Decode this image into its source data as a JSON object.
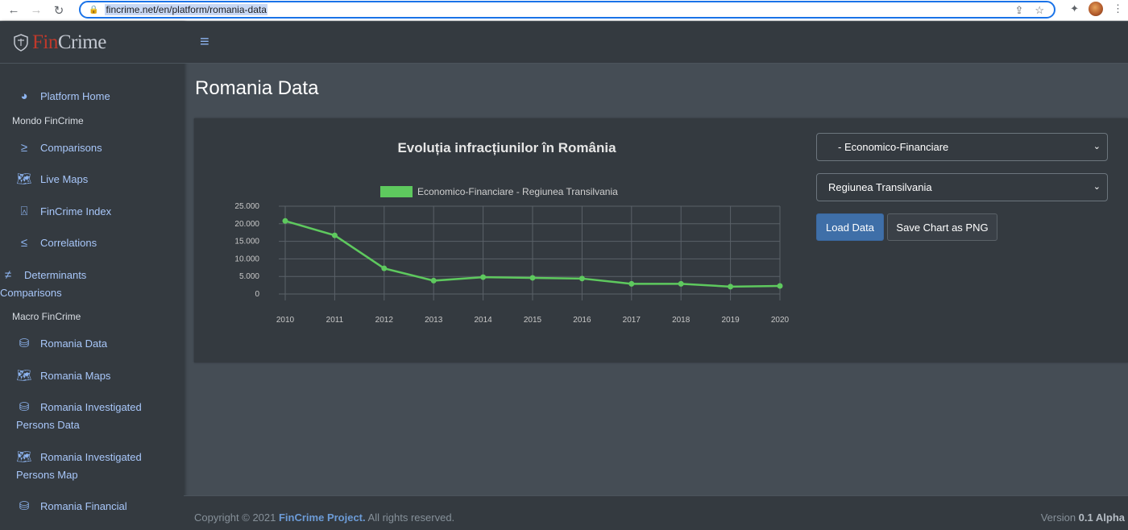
{
  "browser": {
    "url": "fincrime.net/en/platform/romania-data"
  },
  "brand": {
    "part1": "Fin",
    "part2": "Crime"
  },
  "sidebar": {
    "items": [
      {
        "label": "Platform Home",
        "icon": "tachometer-icon"
      },
      {
        "header": "Mondo FinCrime"
      },
      {
        "label": "Comparisons",
        "icon": "greater-equal-icon"
      },
      {
        "label": "Live Maps",
        "icon": "map-icon"
      },
      {
        "label": "FinCrime Index",
        "icon": "broadcast-tower-icon"
      },
      {
        "label": "Correlations",
        "icon": "less-equal-icon"
      },
      {
        "label": "Determinants",
        "label2": "Comparisons",
        "icon": "not-equal-icon"
      },
      {
        "header": "Macro FinCrime"
      },
      {
        "label": "Romania Data",
        "icon": "database-icon"
      },
      {
        "label": "Romania Maps",
        "icon": "map-icon"
      },
      {
        "label": "Romania Investigated",
        "label2": "Persons Data",
        "icon": "database-icon"
      },
      {
        "label": "Romania Investigated",
        "label2": "Persons Map",
        "icon": "map-icon"
      },
      {
        "label": "Romania Financial",
        "icon": "database-icon"
      }
    ]
  },
  "page": {
    "title": "Romania Data"
  },
  "controls": {
    "select1": "- Economico-Financiare",
    "select2": "Regiunea Transilvania",
    "load_button": "Load Data",
    "save_button": "Save Chart as PNG"
  },
  "footer": {
    "copyright_prefix": "Copyright © 2021 ",
    "project": "FinCrime Project.",
    "rights": " All rights reserved.",
    "version_label": "Version ",
    "version": "0.1 Alpha"
  },
  "chart_data": {
    "type": "line",
    "title": "Evoluția infracțiunilor în România",
    "categories": [
      "2010",
      "2011",
      "2012",
      "2013",
      "2014",
      "2015",
      "2016",
      "2017",
      "2018",
      "2019",
      "2020"
    ],
    "series": [
      {
        "name": "Economico-Financiare - Regiunea Transilvania",
        "color": "#5ec95e",
        "values": [
          20800,
          16700,
          7300,
          3800,
          4800,
          4600,
          4400,
          2900,
          2900,
          2100,
          2300
        ]
      }
    ],
    "yticks": [
      "25.000",
      "20.000",
      "15.000",
      "10.000",
      "5.000",
      "0"
    ],
    "ylim": [
      0,
      25000
    ],
    "grid": true,
    "legend": "top"
  }
}
